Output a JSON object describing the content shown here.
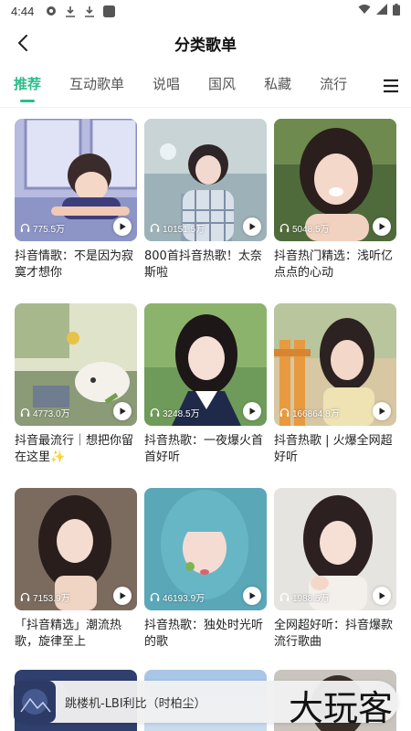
{
  "status_bar": {
    "time": "4:44",
    "left_icons": [
      "settings-status-icon",
      "download-icon",
      "download-icon",
      "app-status-icon"
    ],
    "right_icons": [
      "wifi-icon",
      "signal-icon",
      "battery-icon"
    ]
  },
  "header": {
    "title": "分类歌单",
    "back_icon": "back-arrow-icon"
  },
  "tabs": {
    "items": [
      "推荐",
      "互动歌单",
      "说唱",
      "国风",
      "私藏",
      "流行"
    ],
    "active_index": 0,
    "menu_icon": "menu-icon",
    "accent_color": "#2bbd8a"
  },
  "playlists": [
    {
      "play_count": "775.5万",
      "title": "抖音情歌：不是因为寂寞才想你"
    },
    {
      "play_count": "10151.5万",
      "title": "800首抖音热歌！太奈斯啦"
    },
    {
      "play_count": "5048.5万",
      "title": "抖音热门精选：浅听亿点点的心动"
    },
    {
      "play_count": "4773.0万",
      "title": "抖音最流行｜想把你留在这里✨"
    },
    {
      "play_count": "3248.5万",
      "title": "抖音热歌：一夜爆火首首好听"
    },
    {
      "play_count": "166864.8万",
      "title": "抖音热歌 | 火爆全网超好听"
    },
    {
      "play_count": "7153.9万",
      "title": "「抖音精选」潮流热歌，旋律至上"
    },
    {
      "play_count": "46193.9万",
      "title": "抖音热歌：独处时光听的歌"
    },
    {
      "play_count": "1988.5万",
      "title": "全网超好听：抖音爆款流行歌曲"
    }
  ],
  "mini_player": {
    "song": "跳楼机-LBI利比（时柏尘）"
  },
  "watermark": {
    "text": "大玩客"
  }
}
